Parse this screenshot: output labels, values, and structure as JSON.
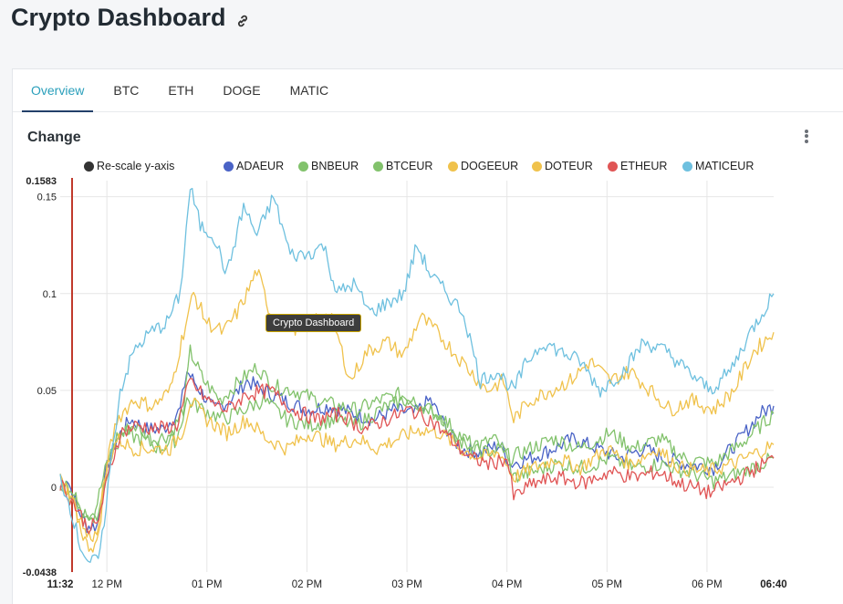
{
  "page": {
    "title": "Crypto Dashboard",
    "link_icon": "link-icon"
  },
  "tabs": [
    "Overview",
    "BTC",
    "ETH",
    "DOGE",
    "MATIC"
  ],
  "active_tab": "Overview",
  "panel": {
    "title": "Change",
    "menu_icon": "kebab-menu-icon"
  },
  "tooltip": "Crypto Dashboard",
  "chart_data": {
    "type": "line",
    "x_ticks": [
      "11:32",
      "12 PM",
      "01 PM",
      "02 PM",
      "03 PM",
      "04 PM",
      "05 PM",
      "06 PM",
      "06:40"
    ],
    "y_ticks": [
      "0.1583",
      "0.15",
      "0.1",
      "0.05",
      "0",
      "-0.0438"
    ],
    "ylim": [
      -0.0438,
      0.1583
    ],
    "x_minutes_range": [
      0,
      428
    ],
    "legend": [
      {
        "name": "Re-scale y-axis",
        "color": "#333333"
      },
      {
        "name": "ADAEUR",
        "color": "#4a63c6"
      },
      {
        "name": "BNBEUR",
        "color": "#82c26c"
      },
      {
        "name": "BTCEUR",
        "color": "#82c26c"
      },
      {
        "name": "DOGEEUR",
        "color": "#f0c24c"
      },
      {
        "name": "DOTEUR",
        "color": "#f0c24c"
      },
      {
        "name": "ETHEUR",
        "color": "#e05555"
      },
      {
        "name": "MATICEUR",
        "color": "#6ec0df"
      }
    ],
    "series": [
      {
        "name": "ADAEUR",
        "color": "#4a63c6",
        "points": [
          [
            0,
            0
          ],
          [
            4,
            0.005
          ],
          [
            10,
            -0.01
          ],
          [
            16,
            -0.02
          ],
          [
            22,
            -0.02
          ],
          [
            28,
            0.01
          ],
          [
            34,
            0.025
          ],
          [
            42,
            0.035
          ],
          [
            52,
            0.03
          ],
          [
            62,
            0.03
          ],
          [
            72,
            0.04
          ],
          [
            76,
            0.06
          ],
          [
            84,
            0.05
          ],
          [
            92,
            0.04
          ],
          [
            102,
            0.045
          ],
          [
            112,
            0.055
          ],
          [
            122,
            0.05
          ],
          [
            134,
            0.045
          ],
          [
            148,
            0.04
          ],
          [
            162,
            0.042
          ],
          [
            176,
            0.038
          ],
          [
            188,
            0.035
          ],
          [
            200,
            0.04
          ],
          [
            212,
            0.038
          ],
          [
            222,
            0.045
          ],
          [
            232,
            0.03
          ],
          [
            240,
            0.02
          ],
          [
            252,
            0.018
          ],
          [
            264,
            0.022
          ],
          [
            270,
            0.012
          ],
          [
            282,
            0.015
          ],
          [
            296,
            0.02
          ],
          [
            308,
            0.025
          ],
          [
            322,
            0.02
          ],
          [
            336,
            0.015
          ],
          [
            350,
            0.02
          ],
          [
            362,
            0.015
          ],
          [
            376,
            0.012
          ],
          [
            392,
            0.01
          ],
          [
            408,
            0.025
          ],
          [
            420,
            0.038
          ],
          [
            428,
            0.042
          ]
        ]
      },
      {
        "name": "BNBEUR",
        "color": "#82c26c",
        "points": [
          [
            0,
            0.002
          ],
          [
            6,
            -0.002
          ],
          [
            14,
            -0.012
          ],
          [
            20,
            -0.015
          ],
          [
            28,
            0.012
          ],
          [
            34,
            0.026
          ],
          [
            44,
            0.032
          ],
          [
            56,
            0.025
          ],
          [
            66,
            0.027
          ],
          [
            74,
            0.04
          ],
          [
            78,
            0.07
          ],
          [
            86,
            0.055
          ],
          [
            96,
            0.045
          ],
          [
            108,
            0.055
          ],
          [
            118,
            0.062
          ],
          [
            128,
            0.052
          ],
          [
            140,
            0.05
          ],
          [
            154,
            0.045
          ],
          [
            166,
            0.042
          ],
          [
            178,
            0.04
          ],
          [
            192,
            0.045
          ],
          [
            204,
            0.048
          ],
          [
            216,
            0.042
          ],
          [
            226,
            0.04
          ],
          [
            236,
            0.025
          ],
          [
            248,
            0.02
          ],
          [
            260,
            0.025
          ],
          [
            270,
            0.015
          ],
          [
            282,
            0.02
          ],
          [
            296,
            0.025
          ],
          [
            312,
            0.02
          ],
          [
            330,
            0.028
          ],
          [
            344,
            0.02
          ],
          [
            360,
            0.025
          ],
          [
            374,
            0.015
          ],
          [
            392,
            0.012
          ],
          [
            408,
            0.022
          ],
          [
            428,
            0.038
          ]
        ]
      },
      {
        "name": "BTCEUR",
        "color": "#82c26c",
        "points": [
          [
            0,
            0.003
          ],
          [
            8,
            -0.005
          ],
          [
            16,
            -0.015
          ],
          [
            22,
            -0.015
          ],
          [
            30,
            0.015
          ],
          [
            38,
            0.028
          ],
          [
            48,
            0.025
          ],
          [
            60,
            0.02
          ],
          [
            70,
            0.025
          ],
          [
            76,
            0.045
          ],
          [
            86,
            0.04
          ],
          [
            98,
            0.035
          ],
          [
            110,
            0.04
          ],
          [
            122,
            0.045
          ],
          [
            136,
            0.035
          ],
          [
            150,
            0.032
          ],
          [
            164,
            0.035
          ],
          [
            178,
            0.032
          ],
          [
            192,
            0.04
          ],
          [
            206,
            0.045
          ],
          [
            218,
            0.042
          ],
          [
            230,
            0.035
          ],
          [
            242,
            0.025
          ],
          [
            254,
            0.018
          ],
          [
            266,
            0.02
          ],
          [
            272,
            0.005
          ],
          [
            284,
            0.008
          ],
          [
            298,
            0.012
          ],
          [
            314,
            0.01
          ],
          [
            330,
            0.015
          ],
          [
            344,
            0.01
          ],
          [
            360,
            0.012
          ],
          [
            376,
            0.008
          ],
          [
            392,
            0.003
          ],
          [
            410,
            0.008
          ],
          [
            428,
            0.015
          ]
        ]
      },
      {
        "name": "DOGEEUR",
        "color": "#f0c24c",
        "points": [
          [
            0,
            0.005
          ],
          [
            8,
            -0.01
          ],
          [
            16,
            -0.03
          ],
          [
            22,
            -0.03
          ],
          [
            28,
            0.01
          ],
          [
            34,
            0.025
          ],
          [
            44,
            0.02
          ],
          [
            56,
            0.02
          ],
          [
            66,
            0.02
          ],
          [
            74,
            0.03
          ],
          [
            78,
            0.045
          ],
          [
            88,
            0.035
          ],
          [
            100,
            0.028
          ],
          [
            112,
            0.035
          ],
          [
            124,
            0.025
          ],
          [
            136,
            0.02
          ],
          [
            150,
            0.028
          ],
          [
            164,
            0.022
          ],
          [
            178,
            0.025
          ],
          [
            190,
            0.02
          ],
          [
            202,
            0.025
          ],
          [
            216,
            0.03
          ],
          [
            228,
            0.028
          ],
          [
            240,
            0.02
          ],
          [
            252,
            0.015
          ],
          [
            264,
            0.018
          ],
          [
            272,
            0.005
          ],
          [
            284,
            0.01
          ],
          [
            298,
            0.015
          ],
          [
            312,
            0.01
          ],
          [
            328,
            0.02
          ],
          [
            342,
            0.012
          ],
          [
            358,
            0.02
          ],
          [
            372,
            0.01
          ],
          [
            388,
            0.008
          ],
          [
            404,
            0.012
          ],
          [
            418,
            0.018
          ],
          [
            428,
            0.022
          ]
        ]
      },
      {
        "name": "DOTEUR",
        "color": "#f0c24c",
        "points": [
          [
            0,
            0.004
          ],
          [
            8,
            -0.008
          ],
          [
            16,
            -0.025
          ],
          [
            22,
            -0.025
          ],
          [
            28,
            0.012
          ],
          [
            34,
            0.035
          ],
          [
            44,
            0.045
          ],
          [
            56,
            0.042
          ],
          [
            66,
            0.05
          ],
          [
            74,
            0.08
          ],
          [
            80,
            0.1
          ],
          [
            88,
            0.085
          ],
          [
            98,
            0.08
          ],
          [
            106,
            0.09
          ],
          [
            112,
            0.1
          ],
          [
            118,
            0.112
          ],
          [
            126,
            0.09
          ],
          [
            136,
            0.085
          ],
          [
            146,
            0.08
          ],
          [
            156,
            0.09
          ],
          [
            164,
            0.085
          ],
          [
            174,
            0.055
          ],
          [
            184,
            0.07
          ],
          [
            196,
            0.075
          ],
          [
            206,
            0.068
          ],
          [
            216,
            0.088
          ],
          [
            226,
            0.08
          ],
          [
            236,
            0.07
          ],
          [
            246,
            0.06
          ],
          [
            256,
            0.05
          ],
          [
            266,
            0.055
          ],
          [
            272,
            0.035
          ],
          [
            282,
            0.045
          ],
          [
            294,
            0.05
          ],
          [
            306,
            0.055
          ],
          [
            318,
            0.065
          ],
          [
            330,
            0.055
          ],
          [
            342,
            0.06
          ],
          [
            354,
            0.05
          ],
          [
            366,
            0.04
          ],
          [
            378,
            0.045
          ],
          [
            392,
            0.04
          ],
          [
            404,
            0.05
          ],
          [
            416,
            0.07
          ],
          [
            428,
            0.08
          ]
        ]
      },
      {
        "name": "ETHEUR",
        "color": "#e05555",
        "points": [
          [
            0,
            0.002
          ],
          [
            8,
            -0.008
          ],
          [
            16,
            -0.02
          ],
          [
            22,
            -0.02
          ],
          [
            30,
            0.01
          ],
          [
            36,
            0.028
          ],
          [
            46,
            0.032
          ],
          [
            58,
            0.03
          ],
          [
            70,
            0.032
          ],
          [
            78,
            0.055
          ],
          [
            88,
            0.045
          ],
          [
            100,
            0.04
          ],
          [
            112,
            0.048
          ],
          [
            126,
            0.05
          ],
          [
            140,
            0.04
          ],
          [
            154,
            0.035
          ],
          [
            168,
            0.038
          ],
          [
            182,
            0.03
          ],
          [
            196,
            0.035
          ],
          [
            210,
            0.04
          ],
          [
            222,
            0.035
          ],
          [
            234,
            0.025
          ],
          [
            246,
            0.015
          ],
          [
            258,
            0.012
          ],
          [
            268,
            0.015
          ],
          [
            272,
            -0.005
          ],
          [
            284,
            0.002
          ],
          [
            298,
            0.005
          ],
          [
            314,
            0.002
          ],
          [
            330,
            0.008
          ],
          [
            344,
            0.005
          ],
          [
            358,
            0.008
          ],
          [
            372,
            0.002
          ],
          [
            390,
            -0.003
          ],
          [
            408,
            0.005
          ],
          [
            428,
            0.015
          ]
        ]
      },
      {
        "name": "MATICEUR",
        "color": "#6ec0df",
        "points": [
          [
            0,
            0.005
          ],
          [
            6,
            -0.01
          ],
          [
            12,
            -0.03
          ],
          [
            18,
            -0.04
          ],
          [
            24,
            -0.035
          ],
          [
            30,
            0.01
          ],
          [
            36,
            0.05
          ],
          [
            44,
            0.07
          ],
          [
            54,
            0.08
          ],
          [
            64,
            0.085
          ],
          [
            72,
            0.1
          ],
          [
            78,
            0.155
          ],
          [
            84,
            0.135
          ],
          [
            92,
            0.13
          ],
          [
            100,
            0.11
          ],
          [
            110,
            0.145
          ],
          [
            118,
            0.13
          ],
          [
            128,
            0.15
          ],
          [
            138,
            0.12
          ],
          [
            148,
            0.12
          ],
          [
            158,
            0.125
          ],
          [
            166,
            0.1
          ],
          [
            176,
            0.105
          ],
          [
            186,
            0.09
          ],
          [
            196,
            0.095
          ],
          [
            206,
            0.1
          ],
          [
            214,
            0.125
          ],
          [
            222,
            0.11
          ],
          [
            232,
            0.1
          ],
          [
            242,
            0.09
          ],
          [
            252,
            0.055
          ],
          [
            262,
            0.06
          ],
          [
            272,
            0.05
          ],
          [
            280,
            0.065
          ],
          [
            290,
            0.075
          ],
          [
            300,
            0.07
          ],
          [
            312,
            0.065
          ],
          [
            324,
            0.05
          ],
          [
            338,
            0.06
          ],
          [
            350,
            0.075
          ],
          [
            364,
            0.07
          ],
          [
            376,
            0.06
          ],
          [
            390,
            0.05
          ],
          [
            402,
            0.06
          ],
          [
            414,
            0.08
          ],
          [
            428,
            0.1
          ]
        ]
      }
    ]
  }
}
